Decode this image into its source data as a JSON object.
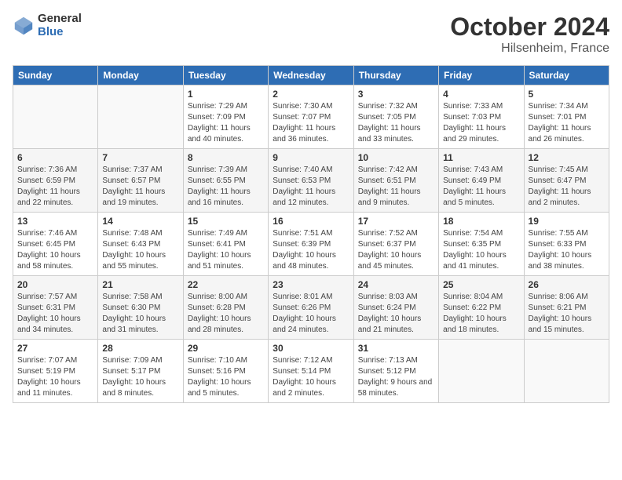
{
  "header": {
    "logo_general": "General",
    "logo_blue": "Blue",
    "month_year": "October 2024",
    "location": "Hilsenheim, France"
  },
  "weekdays": [
    "Sunday",
    "Monday",
    "Tuesday",
    "Wednesday",
    "Thursday",
    "Friday",
    "Saturday"
  ],
  "weeks": [
    [
      {
        "day": "",
        "sunrise": "",
        "sunset": "",
        "daylight": ""
      },
      {
        "day": "",
        "sunrise": "",
        "sunset": "",
        "daylight": ""
      },
      {
        "day": "1",
        "sunrise": "Sunrise: 7:29 AM",
        "sunset": "Sunset: 7:09 PM",
        "daylight": "Daylight: 11 hours and 40 minutes."
      },
      {
        "day": "2",
        "sunrise": "Sunrise: 7:30 AM",
        "sunset": "Sunset: 7:07 PM",
        "daylight": "Daylight: 11 hours and 36 minutes."
      },
      {
        "day": "3",
        "sunrise": "Sunrise: 7:32 AM",
        "sunset": "Sunset: 7:05 PM",
        "daylight": "Daylight: 11 hours and 33 minutes."
      },
      {
        "day": "4",
        "sunrise": "Sunrise: 7:33 AM",
        "sunset": "Sunset: 7:03 PM",
        "daylight": "Daylight: 11 hours and 29 minutes."
      },
      {
        "day": "5",
        "sunrise": "Sunrise: 7:34 AM",
        "sunset": "Sunset: 7:01 PM",
        "daylight": "Daylight: 11 hours and 26 minutes."
      }
    ],
    [
      {
        "day": "6",
        "sunrise": "Sunrise: 7:36 AM",
        "sunset": "Sunset: 6:59 PM",
        "daylight": "Daylight: 11 hours and 22 minutes."
      },
      {
        "day": "7",
        "sunrise": "Sunrise: 7:37 AM",
        "sunset": "Sunset: 6:57 PM",
        "daylight": "Daylight: 11 hours and 19 minutes."
      },
      {
        "day": "8",
        "sunrise": "Sunrise: 7:39 AM",
        "sunset": "Sunset: 6:55 PM",
        "daylight": "Daylight: 11 hours and 16 minutes."
      },
      {
        "day": "9",
        "sunrise": "Sunrise: 7:40 AM",
        "sunset": "Sunset: 6:53 PM",
        "daylight": "Daylight: 11 hours and 12 minutes."
      },
      {
        "day": "10",
        "sunrise": "Sunrise: 7:42 AM",
        "sunset": "Sunset: 6:51 PM",
        "daylight": "Daylight: 11 hours and 9 minutes."
      },
      {
        "day": "11",
        "sunrise": "Sunrise: 7:43 AM",
        "sunset": "Sunset: 6:49 PM",
        "daylight": "Daylight: 11 hours and 5 minutes."
      },
      {
        "day": "12",
        "sunrise": "Sunrise: 7:45 AM",
        "sunset": "Sunset: 6:47 PM",
        "daylight": "Daylight: 11 hours and 2 minutes."
      }
    ],
    [
      {
        "day": "13",
        "sunrise": "Sunrise: 7:46 AM",
        "sunset": "Sunset: 6:45 PM",
        "daylight": "Daylight: 10 hours and 58 minutes."
      },
      {
        "day": "14",
        "sunrise": "Sunrise: 7:48 AM",
        "sunset": "Sunset: 6:43 PM",
        "daylight": "Daylight: 10 hours and 55 minutes."
      },
      {
        "day": "15",
        "sunrise": "Sunrise: 7:49 AM",
        "sunset": "Sunset: 6:41 PM",
        "daylight": "Daylight: 10 hours and 51 minutes."
      },
      {
        "day": "16",
        "sunrise": "Sunrise: 7:51 AM",
        "sunset": "Sunset: 6:39 PM",
        "daylight": "Daylight: 10 hours and 48 minutes."
      },
      {
        "day": "17",
        "sunrise": "Sunrise: 7:52 AM",
        "sunset": "Sunset: 6:37 PM",
        "daylight": "Daylight: 10 hours and 45 minutes."
      },
      {
        "day": "18",
        "sunrise": "Sunrise: 7:54 AM",
        "sunset": "Sunset: 6:35 PM",
        "daylight": "Daylight: 10 hours and 41 minutes."
      },
      {
        "day": "19",
        "sunrise": "Sunrise: 7:55 AM",
        "sunset": "Sunset: 6:33 PM",
        "daylight": "Daylight: 10 hours and 38 minutes."
      }
    ],
    [
      {
        "day": "20",
        "sunrise": "Sunrise: 7:57 AM",
        "sunset": "Sunset: 6:31 PM",
        "daylight": "Daylight: 10 hours and 34 minutes."
      },
      {
        "day": "21",
        "sunrise": "Sunrise: 7:58 AM",
        "sunset": "Sunset: 6:30 PM",
        "daylight": "Daylight: 10 hours and 31 minutes."
      },
      {
        "day": "22",
        "sunrise": "Sunrise: 8:00 AM",
        "sunset": "Sunset: 6:28 PM",
        "daylight": "Daylight: 10 hours and 28 minutes."
      },
      {
        "day": "23",
        "sunrise": "Sunrise: 8:01 AM",
        "sunset": "Sunset: 6:26 PM",
        "daylight": "Daylight: 10 hours and 24 minutes."
      },
      {
        "day": "24",
        "sunrise": "Sunrise: 8:03 AM",
        "sunset": "Sunset: 6:24 PM",
        "daylight": "Daylight: 10 hours and 21 minutes."
      },
      {
        "day": "25",
        "sunrise": "Sunrise: 8:04 AM",
        "sunset": "Sunset: 6:22 PM",
        "daylight": "Daylight: 10 hours and 18 minutes."
      },
      {
        "day": "26",
        "sunrise": "Sunrise: 8:06 AM",
        "sunset": "Sunset: 6:21 PM",
        "daylight": "Daylight: 10 hours and 15 minutes."
      }
    ],
    [
      {
        "day": "27",
        "sunrise": "Sunrise: 7:07 AM",
        "sunset": "Sunset: 5:19 PM",
        "daylight": "Daylight: 10 hours and 11 minutes."
      },
      {
        "day": "28",
        "sunrise": "Sunrise: 7:09 AM",
        "sunset": "Sunset: 5:17 PM",
        "daylight": "Daylight: 10 hours and 8 minutes."
      },
      {
        "day": "29",
        "sunrise": "Sunrise: 7:10 AM",
        "sunset": "Sunset: 5:16 PM",
        "daylight": "Daylight: 10 hours and 5 minutes."
      },
      {
        "day": "30",
        "sunrise": "Sunrise: 7:12 AM",
        "sunset": "Sunset: 5:14 PM",
        "daylight": "Daylight: 10 hours and 2 minutes."
      },
      {
        "day": "31",
        "sunrise": "Sunrise: 7:13 AM",
        "sunset": "Sunset: 5:12 PM",
        "daylight": "Daylight: 9 hours and 58 minutes."
      },
      {
        "day": "",
        "sunrise": "",
        "sunset": "",
        "daylight": ""
      },
      {
        "day": "",
        "sunrise": "",
        "sunset": "",
        "daylight": ""
      }
    ]
  ]
}
